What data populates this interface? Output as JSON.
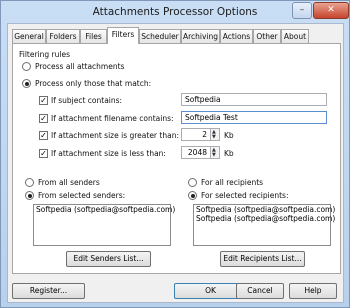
{
  "window": {
    "title": "Attachments Processor Options",
    "min": "–",
    "close": "✕"
  },
  "tabs": [
    "General",
    "Folders",
    "Files",
    "Filters",
    "Scheduler",
    "Archiving",
    "Actions",
    "Other",
    "About"
  ],
  "filter": {
    "group": "Filtering rules",
    "all": "Process all attachments",
    "match": "Process only those that match:",
    "subject": {
      "label": "If subject contains:",
      "value": "Softpedia"
    },
    "filename": {
      "label": "If attachment filename contains:",
      "value": "Softpedia Test"
    },
    "gt": {
      "label": "If attachment size is greater than:",
      "value": "2",
      "unit": "Kb"
    },
    "lt": {
      "label": "If attachment size is less than:",
      "value": "2048",
      "unit": "Kb"
    }
  },
  "senders": {
    "all": "From all senders",
    "selected": "From selected senders:",
    "items": [
      "Softpedia (softpedia@softpedia.com)"
    ],
    "edit": "Edit Senders List..."
  },
  "recipients": {
    "all": "For all recipients",
    "selected": "For selected recipients:",
    "items": [
      "Softpedia (softpedia@softpedia.com)",
      "Softpedia (softpedia@softpedia.com)"
    ],
    "edit": "Edit Recipients List..."
  },
  "buttons": {
    "register": "Register...",
    "ok": "OK",
    "cancel": "Cancel",
    "help": "Help"
  }
}
